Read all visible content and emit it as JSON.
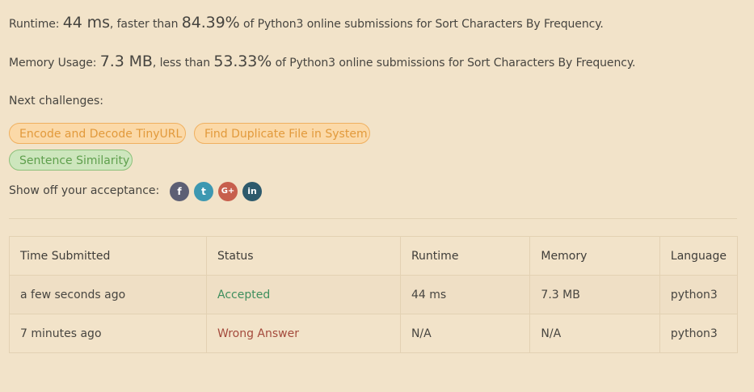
{
  "runtime": {
    "label": "Runtime: ",
    "value": "44 ms",
    "mid": ", faster than ",
    "percent": "84.39%",
    "suffix": " of Python3 online submissions for Sort Characters By Frequency."
  },
  "memory": {
    "label": "Memory Usage: ",
    "value": "7.3 MB",
    "mid": ", less than ",
    "percent": "53.33%",
    "suffix": " of Python3 online submissions for Sort Characters By Frequency."
  },
  "next_challenges": {
    "label": "Next challenges:",
    "items": [
      "Encode and Decode TinyURL",
      "Find Duplicate File in System",
      "Sentence Similarity"
    ]
  },
  "share": {
    "label": "Show off your acceptance:",
    "icons": [
      "facebook-icon",
      "twitter-icon",
      "google-plus-icon",
      "linkedin-icon"
    ],
    "glyphs": [
      "f",
      "t",
      "G+",
      "in"
    ]
  },
  "submissions": {
    "headers": [
      "Time Submitted",
      "Status",
      "Runtime",
      "Memory",
      "Language"
    ],
    "rows": [
      {
        "time": "a few seconds ago",
        "status": "Accepted",
        "runtime": "44 ms",
        "memory": "7.3 MB",
        "language": "python3"
      },
      {
        "time": "7 minutes ago",
        "status": "Wrong Answer",
        "runtime": "N/A",
        "memory": "N/A",
        "language": "python3"
      }
    ]
  },
  "colors": {
    "background": "#f2e3c9",
    "accepted": "#3f8f5e",
    "wrong": "#a44a3c",
    "pill_orange": "#fbd9a8",
    "pill_green": "#cde6bd"
  }
}
